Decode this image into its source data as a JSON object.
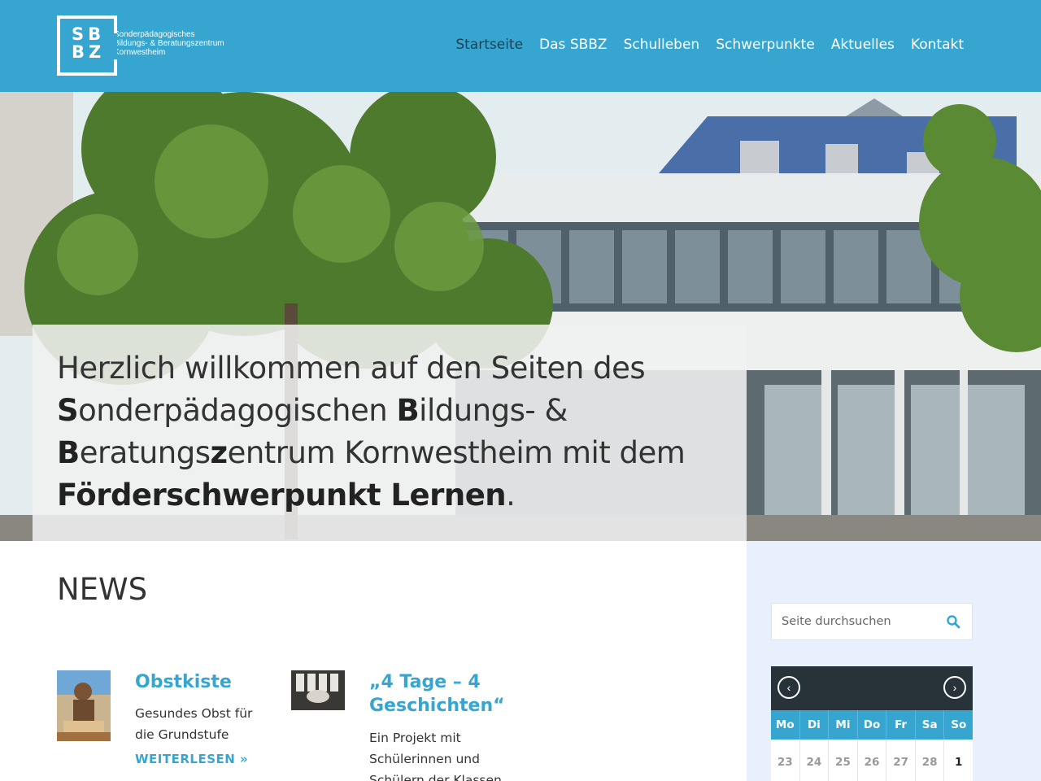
{
  "header": {
    "logo_letters_top": "SB",
    "logo_letters_bottom": "BZ",
    "logo_lines": [
      "Sonderpädagogisches",
      "Bildungs- & Beratungszentrum",
      "Kornwestheim"
    ],
    "nav": [
      {
        "label": "Startseite",
        "active": true
      },
      {
        "label": "Das SBBZ",
        "active": false
      },
      {
        "label": "Schulleben",
        "active": false
      },
      {
        "label": "Schwerpunkte",
        "active": false
      },
      {
        "label": "Aktuelles",
        "active": false
      },
      {
        "label": "Kontakt",
        "active": false
      }
    ]
  },
  "hero": {
    "welcome_part1": "Herzlich willkommen auf den Seiten des ",
    "s_initial": "S",
    "s_rest": "onderpädagogischen ",
    "b_initial": "B",
    "b_rest": "ildungs- & ",
    "b2_initial": "B",
    "b2_rest": "eratungs",
    "z_initial": "z",
    "z_rest": "entrum Kornwestheim mit dem ",
    "focus": "Förderschwerpunkt Lernen",
    "end": "."
  },
  "news": {
    "title": "NEWS",
    "items": [
      {
        "title": "Obstkiste",
        "excerpt": "Gesundes Obst für die Grundstufe",
        "more": "WEITERLESEN »"
      },
      {
        "title": "„4 Tage – 4 Geschichten“",
        "excerpt": "Ein Projekt mit Schülerinnen und Schülern der Klassen"
      }
    ]
  },
  "sidebar": {
    "search_placeholder": "Seite durchsuchen",
    "calendar": {
      "prev": "‹",
      "next": "›",
      "weekdays": [
        "Mo",
        "Di",
        "Mi",
        "Do",
        "Fr",
        "Sa",
        "So"
      ],
      "row1": [
        "23",
        "24",
        "25",
        "26",
        "27",
        "28",
        "1"
      ]
    }
  },
  "colors": {
    "brand_blue": "#36a6d1",
    "dark": "#273239",
    "sidebar_bg": "#e8f0fd"
  }
}
